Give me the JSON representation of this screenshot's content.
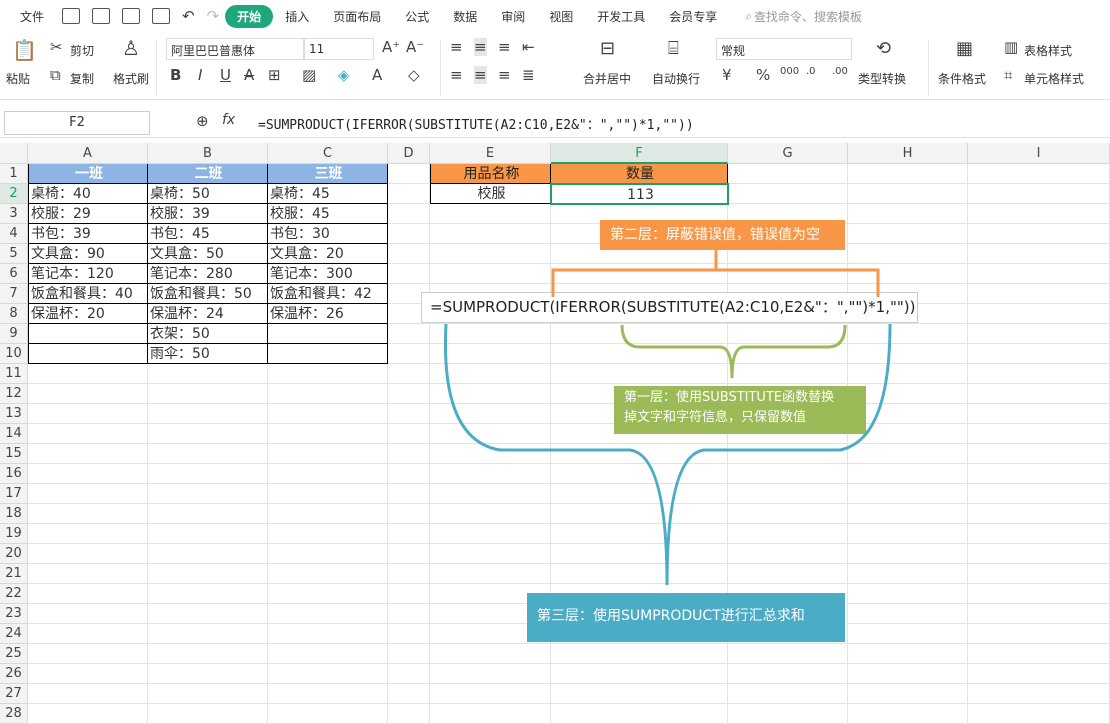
{
  "menu": {
    "file": "文件",
    "tabs": [
      "开始",
      "插入",
      "页面布局",
      "公式",
      "数据",
      "审阅",
      "视图",
      "开发工具",
      "会员专享"
    ],
    "search": "查找命令、搜索模板"
  },
  "ribbon": {
    "paste": "粘贴",
    "cut": "剪切",
    "copy": "复制",
    "format_painter": "格式刷",
    "font": "阿里巴巴普惠体",
    "size": "11",
    "merge": "合并居中",
    "wrap": "自动换行",
    "number_format": "常规",
    "convert": "类型转换",
    "cond_format": "条件格式",
    "table_style": "表格样式",
    "cell_style": "单元格样式"
  },
  "formula_bar": {
    "name_box": "F2",
    "fx": "fx",
    "formula": "=SUMPRODUCT(IFERROR(SUBSTITUTE(A2:C10,E2&\"：\",\"\")*1,\"\"))"
  },
  "columns": [
    "A",
    "B",
    "C",
    "D",
    "E",
    "F",
    "G",
    "H",
    "I"
  ],
  "rows": [
    "1",
    "2",
    "3",
    "4",
    "5",
    "6",
    "7",
    "8",
    "9",
    "10",
    "11",
    "12",
    "13",
    "14",
    "15",
    "16",
    "17",
    "18",
    "19",
    "20",
    "21",
    "22",
    "23",
    "24",
    "25",
    "26",
    "27",
    "28"
  ],
  "table": {
    "headers": [
      "一班",
      "二班",
      "三班"
    ],
    "A": [
      "桌椅：40",
      "校服：29",
      "书包：39",
      "文具盒：90",
      "笔记本：120",
      "饭盒和餐具：40",
      "保温杯：20",
      "",
      ""
    ],
    "B": [
      "桌椅：50",
      "校服：39",
      "书包：45",
      "文具盒：50",
      "笔记本：280",
      "饭盒和餐具：50",
      "保温杯：24",
      "衣架：50",
      "雨伞：50"
    ],
    "C": [
      "桌椅：45",
      "校服：45",
      "书包：30",
      "文具盒：20",
      "笔记本：300",
      "饭盒和餐具：42",
      "保温杯：26",
      "",
      ""
    ]
  },
  "lookup": {
    "h1": "用品名称",
    "h2": "数量",
    "item": "校服",
    "qty": "113"
  },
  "annotations": {
    "layer2": "第二层：屏蔽错误值，错误值为空",
    "formula": "=SUMPRODUCT(IFERROR(SUBSTITUTE(A2:C10,E2&\"：\",\"\")*1,\"\"))",
    "layer1_line1": "第一层：使用SUBSTITUTE函数替换",
    "layer1_line2": "掉文字和字符信息，只保留数值",
    "layer3": "第三层：使用SUMPRODUCT进行汇总求和"
  },
  "colors": {
    "orange": "#f79646",
    "green": "#9bbb59",
    "blue": "#4bacc6",
    "header_blue": "#8db4e2",
    "accent": "#1fa67a"
  }
}
